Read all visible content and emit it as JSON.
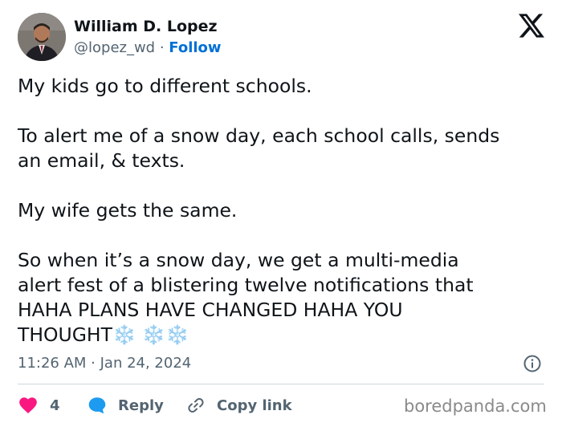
{
  "author": {
    "name": "William D. Lopez",
    "handle": "@lopez_wd",
    "separator": " · ",
    "follow_label": "Follow"
  },
  "tweet": {
    "lines": [
      "My kids go to different schools.",
      "To alert me of a snow day, each school calls, sends",
      "an email, & texts.",
      "My wife gets the same.",
      "So when it’s a snow day, we get a multi-media",
      "alert fest of a blistering twelve notifications that",
      "HAHA PLANS HAVE CHANGED HAHA YOU",
      "THOUGHT"
    ],
    "snow_emojis": "❄️ ❄️❄️"
  },
  "meta": {
    "timestamp": "11:26 AM · Jan 24, 2024"
  },
  "actions": {
    "like_count": "4",
    "reply_label": "Reply",
    "copy_label": "Copy link"
  },
  "watermark": "boredpanda.com",
  "colors": {
    "like": "#f91880",
    "reply": "#1d9bf0",
    "follow": "#006fd6",
    "muted": "#536471"
  }
}
